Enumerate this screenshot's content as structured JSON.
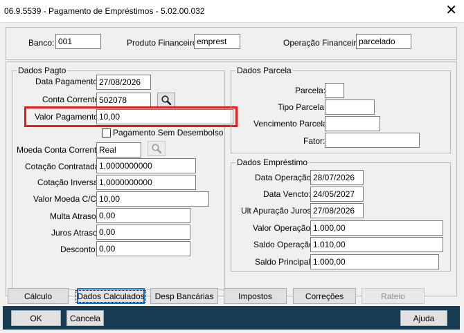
{
  "window": {
    "title": "06.9.5539 - Pagamento de Empréstimos - 5.02.00.032",
    "close_glyph": "✕"
  },
  "header": {
    "banco_label": "Banco:",
    "banco_value": "001",
    "produto_label": "Produto Financeiro:",
    "produto_value": "emprest",
    "operacao_label": "Operação Financeira:",
    "operacao_value": "parcelado"
  },
  "dados_pagto": {
    "title": "Dados Pagto",
    "data_pagamento_label": "Data Pagamento:",
    "data_pagamento_value": "27/08/2026",
    "conta_corrente_label": "Conta Corrente:",
    "conta_corrente_value": "502078",
    "valor_pagamento_label": "Valor Pagamento:",
    "valor_pagamento_value": "10,00",
    "sem_desembolso_label": "Pagamento Sem Desembolso",
    "moeda_label": "Moeda Conta Corrente:",
    "moeda_value": "Real",
    "cotacao_contratada_label": "Cotação Contratada:",
    "cotacao_contratada_value": "1,0000000000",
    "cotacao_inversa_label": "Cotação Inversa:",
    "cotacao_inversa_value": "1,0000000000",
    "valor_moeda_label": "Valor Moeda C/C:",
    "valor_moeda_value": "10,00",
    "multa_label": "Multa Atraso:",
    "multa_value": "0,00",
    "juros_label": "Juros Atraso:",
    "juros_value": "0,00",
    "desconto_label": "Desconto:",
    "desconto_value": "0,00"
  },
  "dados_parcela": {
    "title": "Dados Parcela",
    "parcela_label": "Parcela:",
    "parcela_value": "",
    "tipo_label": "Tipo Parcela:",
    "tipo_value": "",
    "vencimento_label": "Vencimento Parcela:",
    "vencimento_value": "",
    "fator_label": "Fator:",
    "fator_value": ""
  },
  "dados_emprestimo": {
    "title": "Dados Empréstimo",
    "data_operacao_label": "Data Operação:",
    "data_operacao_value": "28/07/2026",
    "data_vencto_label": "Data Vencto:",
    "data_vencto_value": "24/05/2027",
    "ult_apuracao_label": "Ult Apuração Juros:",
    "ult_apuracao_value": "27/08/2026",
    "valor_operacao_label": "Valor Operação:",
    "valor_operacao_value": "1.000,00",
    "saldo_operacao_label": "Saldo Operação:",
    "saldo_operacao_value": "1.010,00",
    "saldo_principal_label": "Saldo Principal:",
    "saldo_principal_value": "1.000,00"
  },
  "actions": {
    "calculo": "Cálculo",
    "dados_calculados": "Dados Calculados",
    "desp_bancarias": "Desp Bancárias",
    "impostos": "Impostos",
    "correcoes": "Correções",
    "rateio": "Rateio"
  },
  "footer": {
    "ok": "OK",
    "cancela": "Cancela",
    "ajuda": "Ajuda"
  },
  "colors": {
    "highlight": "#e31b1b",
    "footer_bg": "#173c52"
  },
  "icons": {
    "search": "search-icon",
    "close": "close-icon"
  }
}
